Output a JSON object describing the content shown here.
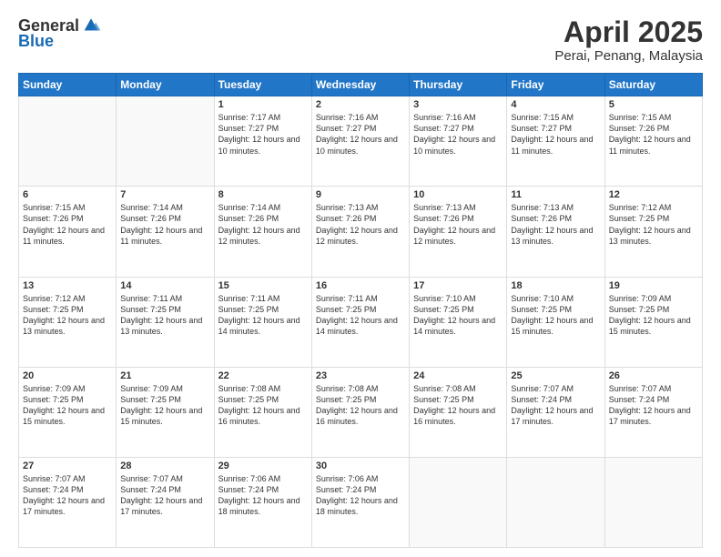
{
  "logo": {
    "general": "General",
    "blue": "Blue"
  },
  "title": "April 2025",
  "subtitle": "Perai, Penang, Malaysia",
  "days_of_week": [
    "Sunday",
    "Monday",
    "Tuesday",
    "Wednesday",
    "Thursday",
    "Friday",
    "Saturday"
  ],
  "weeks": [
    [
      {
        "day": "",
        "info": ""
      },
      {
        "day": "",
        "info": ""
      },
      {
        "day": "1",
        "info": "Sunrise: 7:17 AM\nSunset: 7:27 PM\nDaylight: 12 hours and 10 minutes."
      },
      {
        "day": "2",
        "info": "Sunrise: 7:16 AM\nSunset: 7:27 PM\nDaylight: 12 hours and 10 minutes."
      },
      {
        "day": "3",
        "info": "Sunrise: 7:16 AM\nSunset: 7:27 PM\nDaylight: 12 hours and 10 minutes."
      },
      {
        "day": "4",
        "info": "Sunrise: 7:15 AM\nSunset: 7:27 PM\nDaylight: 12 hours and 11 minutes."
      },
      {
        "day": "5",
        "info": "Sunrise: 7:15 AM\nSunset: 7:26 PM\nDaylight: 12 hours and 11 minutes."
      }
    ],
    [
      {
        "day": "6",
        "info": "Sunrise: 7:15 AM\nSunset: 7:26 PM\nDaylight: 12 hours and 11 minutes."
      },
      {
        "day": "7",
        "info": "Sunrise: 7:14 AM\nSunset: 7:26 PM\nDaylight: 12 hours and 11 minutes."
      },
      {
        "day": "8",
        "info": "Sunrise: 7:14 AM\nSunset: 7:26 PM\nDaylight: 12 hours and 12 minutes."
      },
      {
        "day": "9",
        "info": "Sunrise: 7:13 AM\nSunset: 7:26 PM\nDaylight: 12 hours and 12 minutes."
      },
      {
        "day": "10",
        "info": "Sunrise: 7:13 AM\nSunset: 7:26 PM\nDaylight: 12 hours and 12 minutes."
      },
      {
        "day": "11",
        "info": "Sunrise: 7:13 AM\nSunset: 7:26 PM\nDaylight: 12 hours and 13 minutes."
      },
      {
        "day": "12",
        "info": "Sunrise: 7:12 AM\nSunset: 7:25 PM\nDaylight: 12 hours and 13 minutes."
      }
    ],
    [
      {
        "day": "13",
        "info": "Sunrise: 7:12 AM\nSunset: 7:25 PM\nDaylight: 12 hours and 13 minutes."
      },
      {
        "day": "14",
        "info": "Sunrise: 7:11 AM\nSunset: 7:25 PM\nDaylight: 12 hours and 13 minutes."
      },
      {
        "day": "15",
        "info": "Sunrise: 7:11 AM\nSunset: 7:25 PM\nDaylight: 12 hours and 14 minutes."
      },
      {
        "day": "16",
        "info": "Sunrise: 7:11 AM\nSunset: 7:25 PM\nDaylight: 12 hours and 14 minutes."
      },
      {
        "day": "17",
        "info": "Sunrise: 7:10 AM\nSunset: 7:25 PM\nDaylight: 12 hours and 14 minutes."
      },
      {
        "day": "18",
        "info": "Sunrise: 7:10 AM\nSunset: 7:25 PM\nDaylight: 12 hours and 15 minutes."
      },
      {
        "day": "19",
        "info": "Sunrise: 7:09 AM\nSunset: 7:25 PM\nDaylight: 12 hours and 15 minutes."
      }
    ],
    [
      {
        "day": "20",
        "info": "Sunrise: 7:09 AM\nSunset: 7:25 PM\nDaylight: 12 hours and 15 minutes."
      },
      {
        "day": "21",
        "info": "Sunrise: 7:09 AM\nSunset: 7:25 PM\nDaylight: 12 hours and 15 minutes."
      },
      {
        "day": "22",
        "info": "Sunrise: 7:08 AM\nSunset: 7:25 PM\nDaylight: 12 hours and 16 minutes."
      },
      {
        "day": "23",
        "info": "Sunrise: 7:08 AM\nSunset: 7:25 PM\nDaylight: 12 hours and 16 minutes."
      },
      {
        "day": "24",
        "info": "Sunrise: 7:08 AM\nSunset: 7:25 PM\nDaylight: 12 hours and 16 minutes."
      },
      {
        "day": "25",
        "info": "Sunrise: 7:07 AM\nSunset: 7:24 PM\nDaylight: 12 hours and 17 minutes."
      },
      {
        "day": "26",
        "info": "Sunrise: 7:07 AM\nSunset: 7:24 PM\nDaylight: 12 hours and 17 minutes."
      }
    ],
    [
      {
        "day": "27",
        "info": "Sunrise: 7:07 AM\nSunset: 7:24 PM\nDaylight: 12 hours and 17 minutes."
      },
      {
        "day": "28",
        "info": "Sunrise: 7:07 AM\nSunset: 7:24 PM\nDaylight: 12 hours and 17 minutes."
      },
      {
        "day": "29",
        "info": "Sunrise: 7:06 AM\nSunset: 7:24 PM\nDaylight: 12 hours and 18 minutes."
      },
      {
        "day": "30",
        "info": "Sunrise: 7:06 AM\nSunset: 7:24 PM\nDaylight: 12 hours and 18 minutes."
      },
      {
        "day": "",
        "info": ""
      },
      {
        "day": "",
        "info": ""
      },
      {
        "day": "",
        "info": ""
      }
    ]
  ]
}
